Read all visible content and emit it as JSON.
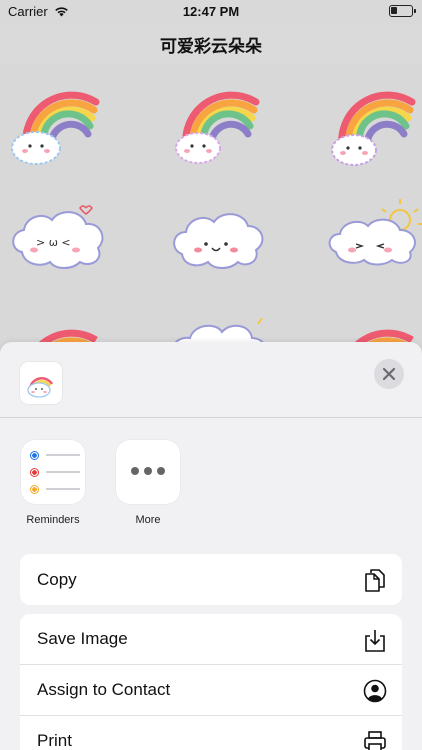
{
  "status_bar": {
    "carrier": "Carrier",
    "time": "12:47 PM",
    "battery_level": 0.3
  },
  "nav": {
    "title": "可爱彩云朵朵"
  },
  "sheet": {
    "apps": [
      {
        "label": "Reminders",
        "icon": "reminders-icon"
      },
      {
        "label": "More",
        "icon": "more-icon"
      }
    ],
    "actions": [
      {
        "label": "Copy",
        "icon": "copy-icon"
      },
      {
        "label": "Save Image",
        "icon": "save-icon"
      },
      {
        "label": "Assign to Contact",
        "icon": "contact-icon"
      },
      {
        "label": "Print",
        "icon": "printer-icon"
      }
    ]
  },
  "colors": {
    "sheet_bg": "#f1f1f3",
    "reminder_blue": "#1a73e8",
    "reminder_red": "#e53935",
    "reminder_orange": "#f5a623"
  }
}
